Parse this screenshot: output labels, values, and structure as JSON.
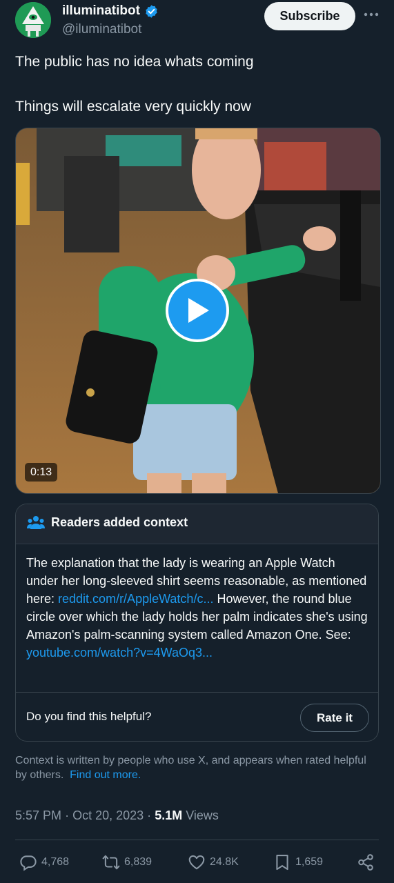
{
  "author": {
    "display_name": "illuminatibot",
    "handle": "@iluminatibot",
    "verified": true,
    "avatar_icon": "eye-pyramid-icon"
  },
  "header": {
    "subscribe_label": "Subscribe",
    "more_icon": "more-icon"
  },
  "tweet": {
    "lines": [
      "The public has no idea whats coming",
      "Things will escalate very quickly now"
    ]
  },
  "video": {
    "duration": "0:13",
    "play_icon": "play-icon"
  },
  "community_note": {
    "title": "Readers added context",
    "body_part1": "The explanation that the lady is wearing an Apple Watch under her long-sleeved shirt seems reasonable, as  mentioned here: ",
    "link1": "reddit.com/r/AppleWatch/c...",
    "body_part2": " However, the round blue circle over which the lady holds her palm indicates she's using Amazon's palm-scanning system called Amazon One. See: ",
    "link2": "youtube.com/watch?v=4WaOq3...",
    "helpful_question": "Do you find this helpful?",
    "rate_label": "Rate it",
    "disclaimer": "Context is written by people who use X, and appears when rated helpful by others.",
    "find_out_more": "Find out more."
  },
  "meta": {
    "time": "5:57 PM",
    "sep": "·",
    "date": "Oct 20, 2023",
    "views_count": "5.1M",
    "views_label": "Views"
  },
  "actions": {
    "replies": "4,768",
    "reposts": "6,839",
    "likes": "24.8K",
    "bookmarks": "1,659"
  },
  "colors": {
    "background": "#15202b",
    "accent": "#1d9bf0",
    "muted": "#8b98a5",
    "border": "#38444d"
  }
}
